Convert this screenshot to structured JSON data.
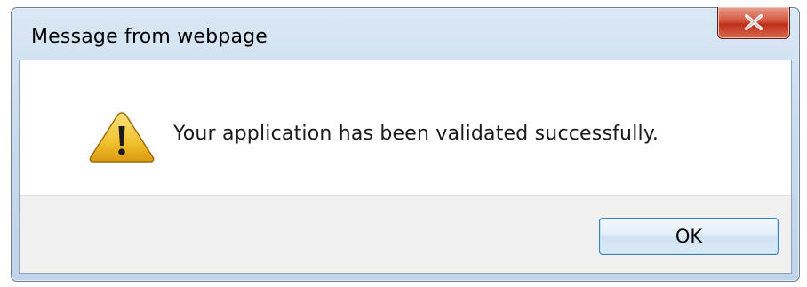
{
  "dialog": {
    "title": "Message from webpage",
    "message": "Your application has been validated successfully.",
    "ok_label": "OK",
    "close_glyph": "✕",
    "icon": "warning-icon"
  },
  "colors": {
    "title_bar": "#c9dbee",
    "close_button": "#c7432a",
    "button_area": "#f0f0f0",
    "ok_border": "#3c7fb1",
    "warning_yellow": "#f2c12e"
  }
}
